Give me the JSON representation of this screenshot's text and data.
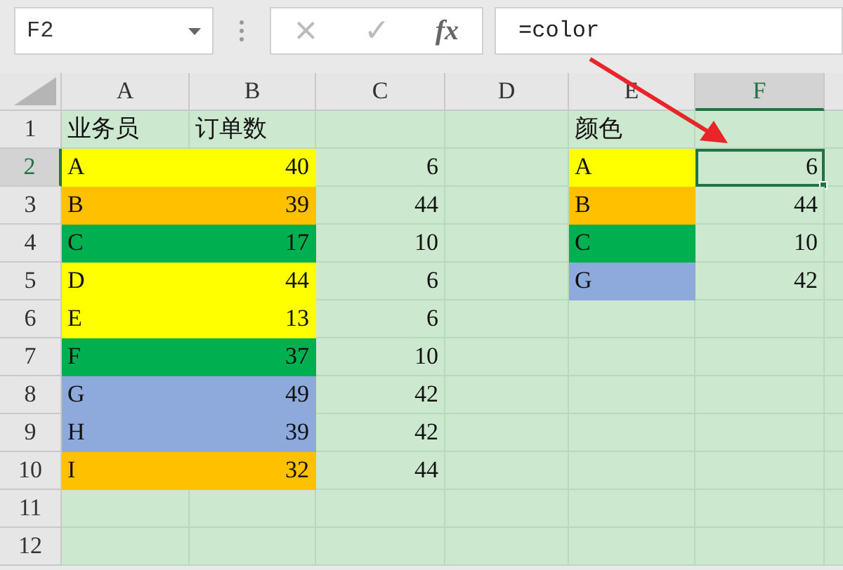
{
  "name_box": {
    "value": "F2"
  },
  "formula_bar": {
    "cancel": "×",
    "enter": "✓",
    "fx": "fx",
    "value": "=color"
  },
  "columns": [
    {
      "label": "A",
      "selected": false
    },
    {
      "label": "B",
      "selected": false
    },
    {
      "label": "C",
      "selected": false
    },
    {
      "label": "D",
      "selected": false
    },
    {
      "label": "E",
      "selected": false
    },
    {
      "label": "F",
      "selected": true
    }
  ],
  "rows": [
    {
      "label": "1",
      "selected": false,
      "cells": {
        "A": {
          "text": "业务员",
          "kind": "text"
        },
        "B": {
          "text": "订单数",
          "kind": "text"
        },
        "E": {
          "text": "颜色",
          "kind": "text"
        }
      }
    },
    {
      "label": "2",
      "selected": true,
      "cells": {
        "A": {
          "text": "A",
          "kind": "text",
          "color": "#ffff00"
        },
        "B": {
          "text": "40",
          "kind": "number",
          "color": "#ffff00"
        },
        "C": {
          "text": "6",
          "kind": "number"
        },
        "E": {
          "text": "A",
          "kind": "text",
          "color": "#ffff00"
        },
        "F": {
          "text": "6",
          "kind": "number",
          "selected": true
        }
      }
    },
    {
      "label": "3",
      "selected": false,
      "cells": {
        "A": {
          "text": "B",
          "kind": "text",
          "color": "#ffc000"
        },
        "B": {
          "text": "39",
          "kind": "number",
          "color": "#ffc000"
        },
        "C": {
          "text": "44",
          "kind": "number"
        },
        "E": {
          "text": "B",
          "kind": "text",
          "color": "#ffc000"
        },
        "F": {
          "text": "44",
          "kind": "number"
        }
      }
    },
    {
      "label": "4",
      "selected": false,
      "cells": {
        "A": {
          "text": "C",
          "kind": "text",
          "color": "#00b050"
        },
        "B": {
          "text": "17",
          "kind": "number",
          "color": "#00b050"
        },
        "C": {
          "text": "10",
          "kind": "number"
        },
        "E": {
          "text": "C",
          "kind": "text",
          "color": "#00b050"
        },
        "F": {
          "text": "10",
          "kind": "number"
        }
      }
    },
    {
      "label": "5",
      "selected": false,
      "cells": {
        "A": {
          "text": "D",
          "kind": "text",
          "color": "#ffff00"
        },
        "B": {
          "text": "44",
          "kind": "number",
          "color": "#ffff00"
        },
        "C": {
          "text": "6",
          "kind": "number"
        },
        "E": {
          "text": "G",
          "kind": "text",
          "color": "#8ea9db"
        },
        "F": {
          "text": "42",
          "kind": "number"
        }
      }
    },
    {
      "label": "6",
      "selected": false,
      "cells": {
        "A": {
          "text": "E",
          "kind": "text",
          "color": "#ffff00"
        },
        "B": {
          "text": "13",
          "kind": "number",
          "color": "#ffff00"
        },
        "C": {
          "text": "6",
          "kind": "number"
        }
      }
    },
    {
      "label": "7",
      "selected": false,
      "cells": {
        "A": {
          "text": "F",
          "kind": "text",
          "color": "#00b050"
        },
        "B": {
          "text": "37",
          "kind": "number",
          "color": "#00b050"
        },
        "C": {
          "text": "10",
          "kind": "number"
        }
      }
    },
    {
      "label": "8",
      "selected": false,
      "cells": {
        "A": {
          "text": "G",
          "kind": "text",
          "color": "#8ea9db"
        },
        "B": {
          "text": "49",
          "kind": "number",
          "color": "#8ea9db"
        },
        "C": {
          "text": "42",
          "kind": "number"
        }
      }
    },
    {
      "label": "9",
      "selected": false,
      "cells": {
        "A": {
          "text": "H",
          "kind": "text",
          "color": "#8ea9db"
        },
        "B": {
          "text": "39",
          "kind": "number",
          "color": "#8ea9db"
        },
        "C": {
          "text": "42",
          "kind": "number"
        }
      }
    },
    {
      "label": "10",
      "selected": false,
      "cells": {
        "A": {
          "text": "I",
          "kind": "text",
          "color": "#ffc000"
        },
        "B": {
          "text": "32",
          "kind": "number",
          "color": "#ffc000"
        },
        "C": {
          "text": "44",
          "kind": "number"
        }
      }
    },
    {
      "label": "11",
      "selected": false,
      "cells": {}
    },
    {
      "label": "12",
      "selected": false,
      "cells": {}
    }
  ]
}
